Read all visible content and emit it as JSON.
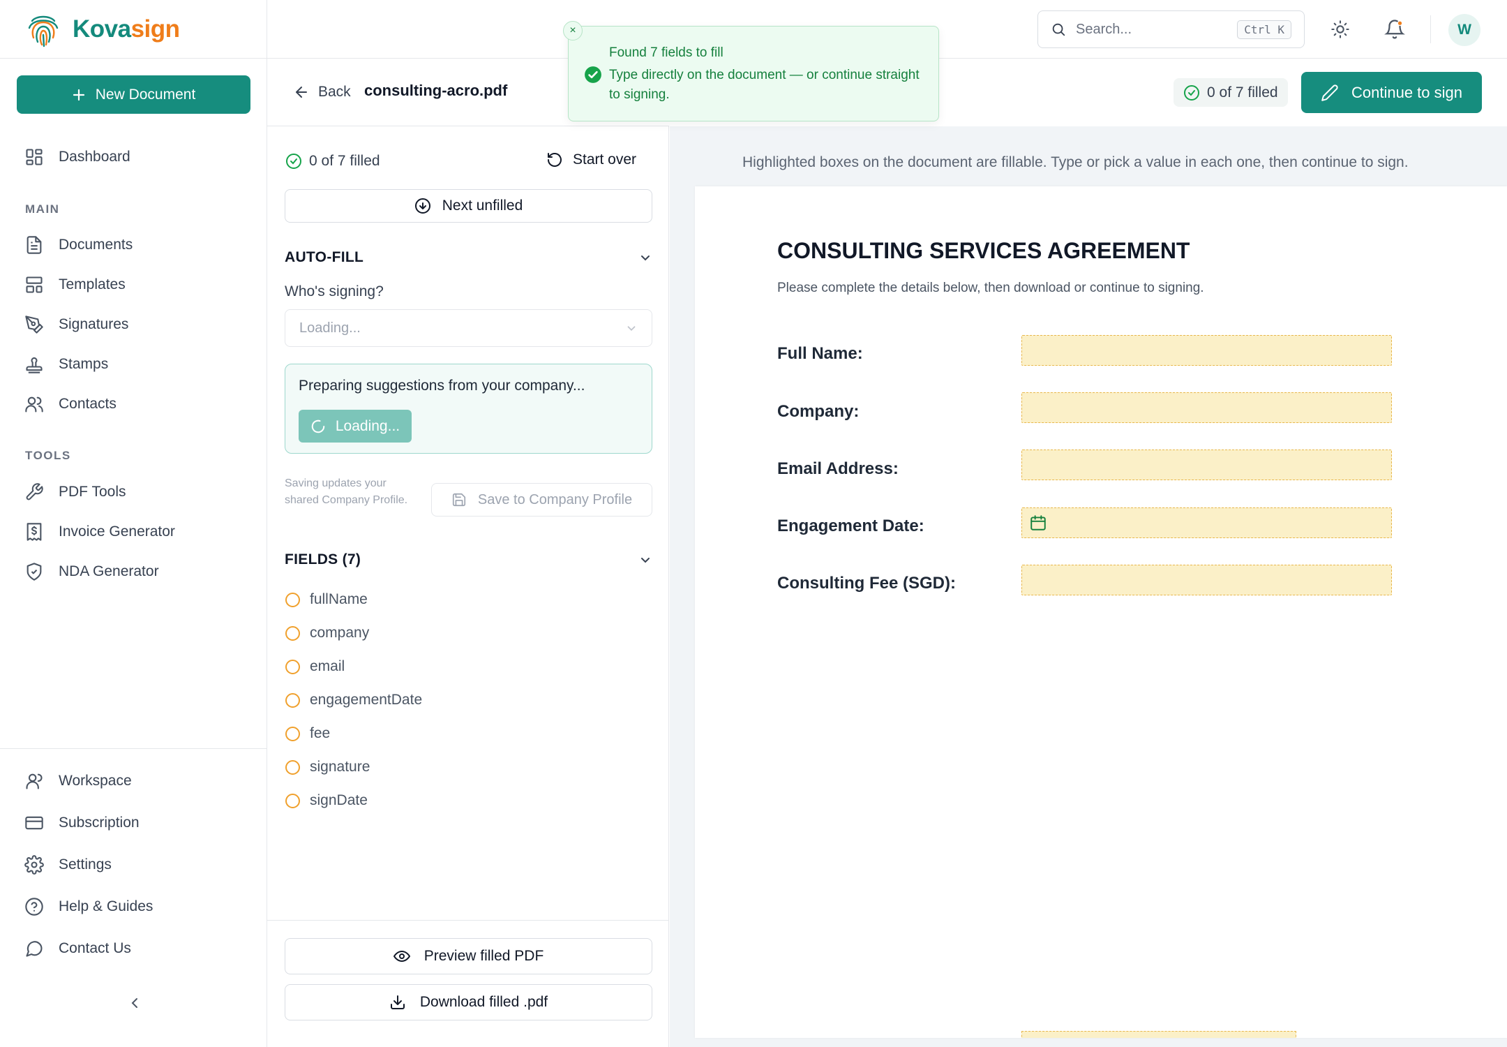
{
  "brand": {
    "name_part1": "Kova",
    "name_part2": "sign"
  },
  "sidebar": {
    "new_document": "New Document",
    "dashboard": "Dashboard",
    "main_label": "MAIN",
    "main_items": [
      {
        "label": "Documents",
        "icon": "document-icon"
      },
      {
        "label": "Templates",
        "icon": "templates-icon"
      },
      {
        "label": "Signatures",
        "icon": "pen-nib-icon"
      },
      {
        "label": "Stamps",
        "icon": "stamp-icon"
      },
      {
        "label": "Contacts",
        "icon": "users-icon"
      }
    ],
    "tools_label": "TOOLS",
    "tools_items": [
      {
        "label": "PDF Tools",
        "icon": "wrench-icon"
      },
      {
        "label": "Invoice Generator",
        "icon": "invoice-icon"
      },
      {
        "label": "NDA Generator",
        "icon": "shield-check-icon"
      }
    ],
    "bottom_items": [
      {
        "label": "Workspace",
        "icon": "user-icon"
      },
      {
        "label": "Subscription",
        "icon": "credit-card-icon"
      },
      {
        "label": "Settings",
        "icon": "gear-icon"
      },
      {
        "label": "Help & Guides",
        "icon": "help-circle-icon"
      },
      {
        "label": "Contact Us",
        "icon": "chat-bubble-icon"
      }
    ]
  },
  "topbar": {
    "search_placeholder": "Search...",
    "shortcut": "Ctrl K",
    "avatar_initial": "W"
  },
  "toast": {
    "title": "Found 7 fields to fill",
    "body": "Type directly on the document — or continue straight to signing.",
    "close": "×"
  },
  "header": {
    "back": "Back",
    "filename": "consulting-acro.pdf",
    "filled_status": "0 of 7 filled",
    "continue": "Continue to sign"
  },
  "panel": {
    "status": "0 of 7 filled",
    "start_over": "Start over",
    "next_unfilled": "Next unfilled",
    "autofill_heading": "AUTO-FILL",
    "who_signing": "Who's signing?",
    "select_value": "Loading...",
    "suggest_text": "Preparing suggestions from your company...",
    "loading_label": "Loading...",
    "save_note": "Saving updates your shared Company Profile.",
    "save_button": "Save to Company Profile",
    "fields_heading": "FIELDS (7)",
    "fields": [
      "fullName",
      "company",
      "email",
      "engagementDate",
      "fee",
      "signature",
      "signDate"
    ],
    "preview": "Preview filled PDF",
    "download": "Download filled .pdf"
  },
  "document": {
    "hint": "Highlighted boxes on the document are fillable. Type or pick a value in each one, then continue to sign.",
    "title": "CONSULTING SERVICES AGREEMENT",
    "subtitle": "Please complete the details below, then download or continue to signing.",
    "fields": [
      {
        "label": "Full Name:"
      },
      {
        "label": "Company:"
      },
      {
        "label": "Email Address:"
      },
      {
        "label": "Engagement Date:"
      },
      {
        "label": "Consulting Fee (SGD):"
      }
    ]
  },
  "colors": {
    "brand_teal": "#168d7e",
    "brand_orange": "#ef7d1a",
    "field_fill": "#fbf0c8",
    "pending_ring": "#f0a02c",
    "toast_green": "#15803d"
  }
}
